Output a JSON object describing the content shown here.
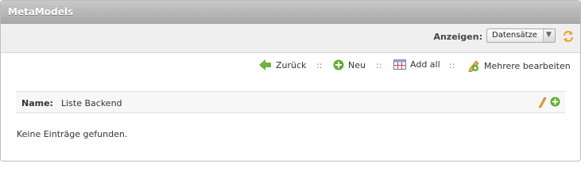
{
  "window": {
    "title": "MetaModels"
  },
  "filter": {
    "label": "Anzeigen:",
    "selected": "Datensätze"
  },
  "toolbar": {
    "back_label": "Zurück",
    "new_label": "Neu",
    "addall_label": "Add all",
    "multi_edit_label": "Mehrere bearbeiten",
    "separator": "::"
  },
  "list": {
    "header_label": "Name:",
    "header_value": "Liste Backend",
    "empty_message": "Keine Einträge gefunden."
  },
  "icons": {
    "back": "arrow-left-icon",
    "new": "plus-circle-icon",
    "addall": "table-add-icon",
    "multi_edit": "pencil-edit-icon",
    "refresh": "refresh-icon",
    "edit": "pencil-icon",
    "add": "plus-circle-icon"
  },
  "colors": {
    "accent_green": "#5fae2e",
    "titlebar": "#b5b5b5",
    "refresh": "#e8a317"
  }
}
